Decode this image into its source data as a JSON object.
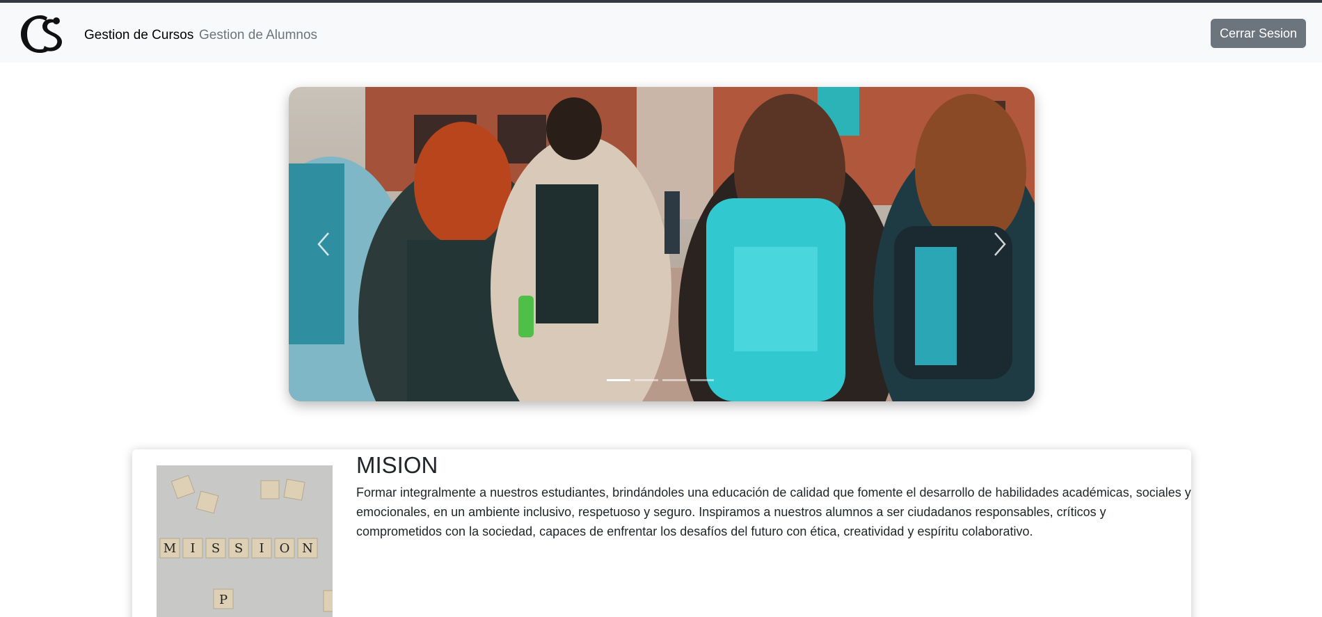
{
  "navbar": {
    "brand_icon": "cs-monogram-logo",
    "links": [
      {
        "label": "Gestion de Cursos",
        "active": true
      },
      {
        "label": "Gestion de Alumnos",
        "active": false
      }
    ],
    "logout_label": "Cerrar Sesion"
  },
  "carousel": {
    "image": "students-with-backpacks-photo",
    "prev_icon": "chevron-left-icon",
    "next_icon": "chevron-right-icon",
    "slide_count": 4,
    "active_index": 0
  },
  "mission": {
    "image": "scrabble-tiles-mission-photo",
    "title": "MISION",
    "text": "Formar integralmente a nuestros estudiantes, brindándoles una educación de calidad que fomente el desarrollo de habilidades académicas, sociales y emocionales, en un ambiente inclusivo, respetuoso y seguro. Inspiramos a nuestros alumnos a ser ciudadanos responsables, críticos y comprometidos con la sociedad, capaces de enfrentar los desafíos del futuro con ética, creatividad y espíritu colaborativo."
  },
  "colors": {
    "navbar_bg": "#f8f9fa",
    "button_secondary": "#6c757d",
    "text_dark": "#212529"
  }
}
